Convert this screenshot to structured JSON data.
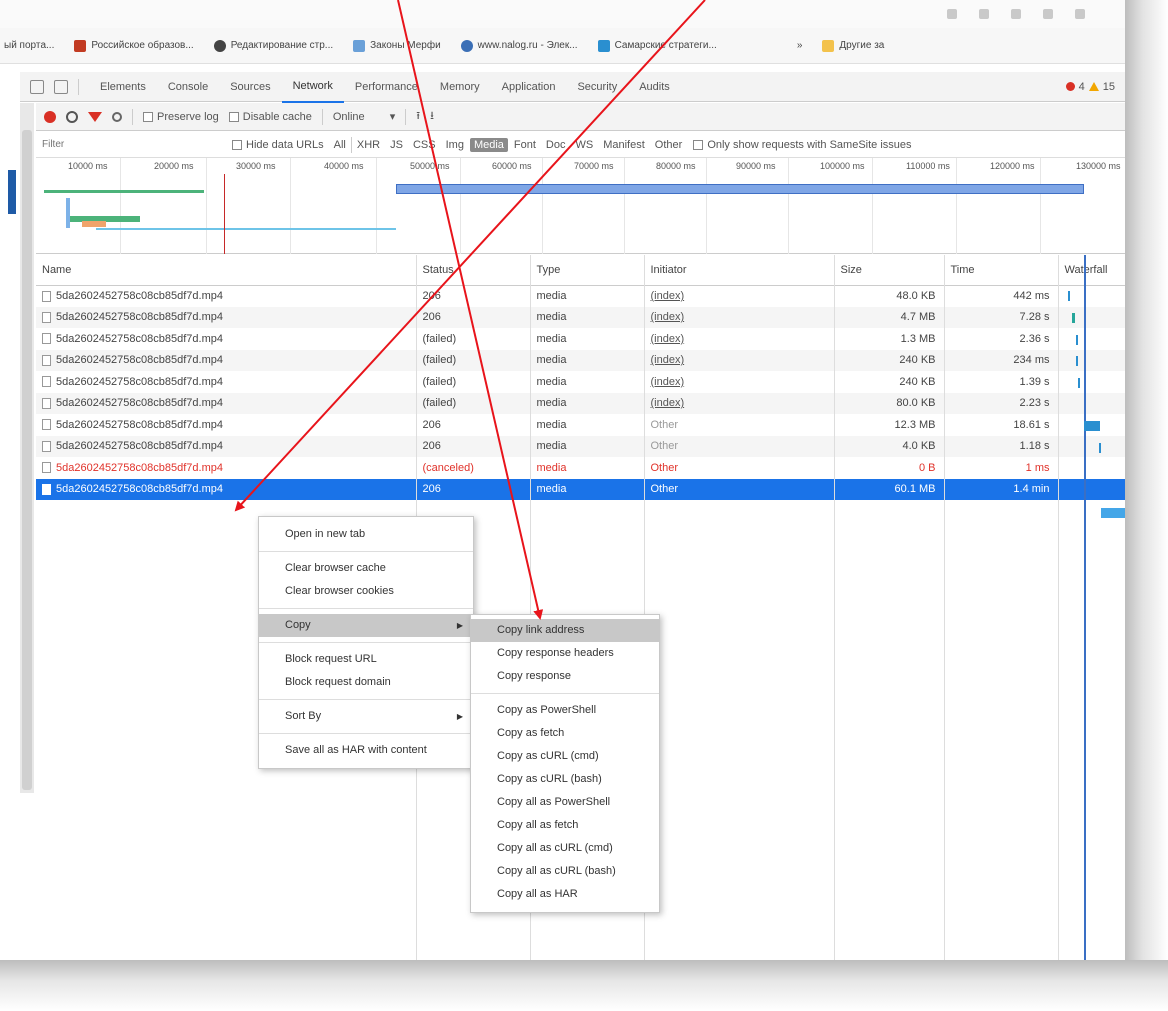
{
  "bookmarks": [
    "ый портa...",
    "Российское образов...",
    "Редактирование стр...",
    "Законы Мерфи",
    "www.nalog.ru - Элек...",
    "Самарские стратеги...",
    "»",
    "Другие за"
  ],
  "devtools": {
    "tabs": [
      "Elements",
      "Console",
      "Sources",
      "Network",
      "Performance",
      "Memory",
      "Application",
      "Security",
      "Audits"
    ],
    "active_tab": "Network",
    "errors": "4",
    "warnings": "15"
  },
  "toolbar": {
    "preserve_log": "Preserve log",
    "disable_cache": "Disable cache",
    "throttle": "Online"
  },
  "filterbar": {
    "placeholder": "Filter",
    "hide_data_urls": "Hide data URLs",
    "types": [
      "All",
      "XHR",
      "JS",
      "CSS",
      "Img",
      "Media",
      "Font",
      "Doc",
      "WS",
      "Manifest",
      "Other"
    ],
    "active_type": "Media",
    "samesite": "Only show requests with SameSite issues"
  },
  "overview": {
    "ticks": [
      "10000 ms",
      "20000 ms",
      "30000 ms",
      "40000 ms",
      "50000 ms",
      "60000 ms",
      "70000 ms",
      "80000 ms",
      "90000 ms",
      "100000 ms",
      "110000 ms",
      "120000 ms",
      "130000 ms"
    ]
  },
  "table": {
    "headers": [
      "Name",
      "Status",
      "Type",
      "Initiator",
      "Size",
      "Time",
      "Waterfall"
    ],
    "rows": [
      {
        "name": "5da2602452758c08cb85df7d.mp4",
        "status": "206",
        "type": "media",
        "initiator": "(index)",
        "size": "48.0 KB",
        "time": "442 ms"
      },
      {
        "name": "5da2602452758c08cb85df7d.mp4",
        "status": "206",
        "type": "media",
        "initiator": "(index)",
        "size": "4.7 MB",
        "time": "7.28 s"
      },
      {
        "name": "5da2602452758c08cb85df7d.mp4",
        "status": "(failed)",
        "type": "media",
        "initiator": "(index)",
        "size": "1.3 MB",
        "time": "2.36 s"
      },
      {
        "name": "5da2602452758c08cb85df7d.mp4",
        "status": "(failed)",
        "type": "media",
        "initiator": "(index)",
        "size": "240 KB",
        "time": "234 ms"
      },
      {
        "name": "5da2602452758c08cb85df7d.mp4",
        "status": "(failed)",
        "type": "media",
        "initiator": "(index)",
        "size": "240 KB",
        "time": "1.39 s"
      },
      {
        "name": "5da2602452758c08cb85df7d.mp4",
        "status": "(failed)",
        "type": "media",
        "initiator": "(index)",
        "size": "80.0 KB",
        "time": "2.23 s"
      },
      {
        "name": "5da2602452758c08cb85df7d.mp4",
        "status": "206",
        "type": "media",
        "initiator": "Other",
        "size": "12.3 MB",
        "time": "18.61 s"
      },
      {
        "name": "5da2602452758c08cb85df7d.mp4",
        "status": "206",
        "type": "media",
        "initiator": "Other",
        "size": "4.0 KB",
        "time": "1.18 s"
      },
      {
        "name": "5da2602452758c08cb85df7d.mp4",
        "status": "(canceled)",
        "type": "media",
        "initiator": "Other",
        "size": "0 B",
        "time": "1 ms"
      },
      {
        "name": "5da2602452758c08cb85df7d.mp4",
        "status": "206",
        "type": "media",
        "initiator": "Other",
        "size": "60.1 MB",
        "time": "1.4 min"
      }
    ]
  },
  "context_menu": {
    "items": [
      "Open in new tab",
      "Clear browser cache",
      "Clear browser cookies",
      "Copy",
      "Block request URL",
      "Block request domain",
      "Sort By",
      "Save all as HAR with content"
    ]
  },
  "copy_submenu": {
    "items": [
      "Copy link address",
      "Copy response headers",
      "Copy response",
      "Copy as PowerShell",
      "Copy as fetch",
      "Copy as cURL (cmd)",
      "Copy as cURL (bash)",
      "Copy all as PowerShell",
      "Copy all as fetch",
      "Copy all as cURL (cmd)",
      "Copy all as cURL (bash)",
      "Copy all as HAR"
    ]
  },
  "colors": {
    "accent": "#1a73e8",
    "annotation": "#e8141b",
    "error": "#d93025"
  }
}
